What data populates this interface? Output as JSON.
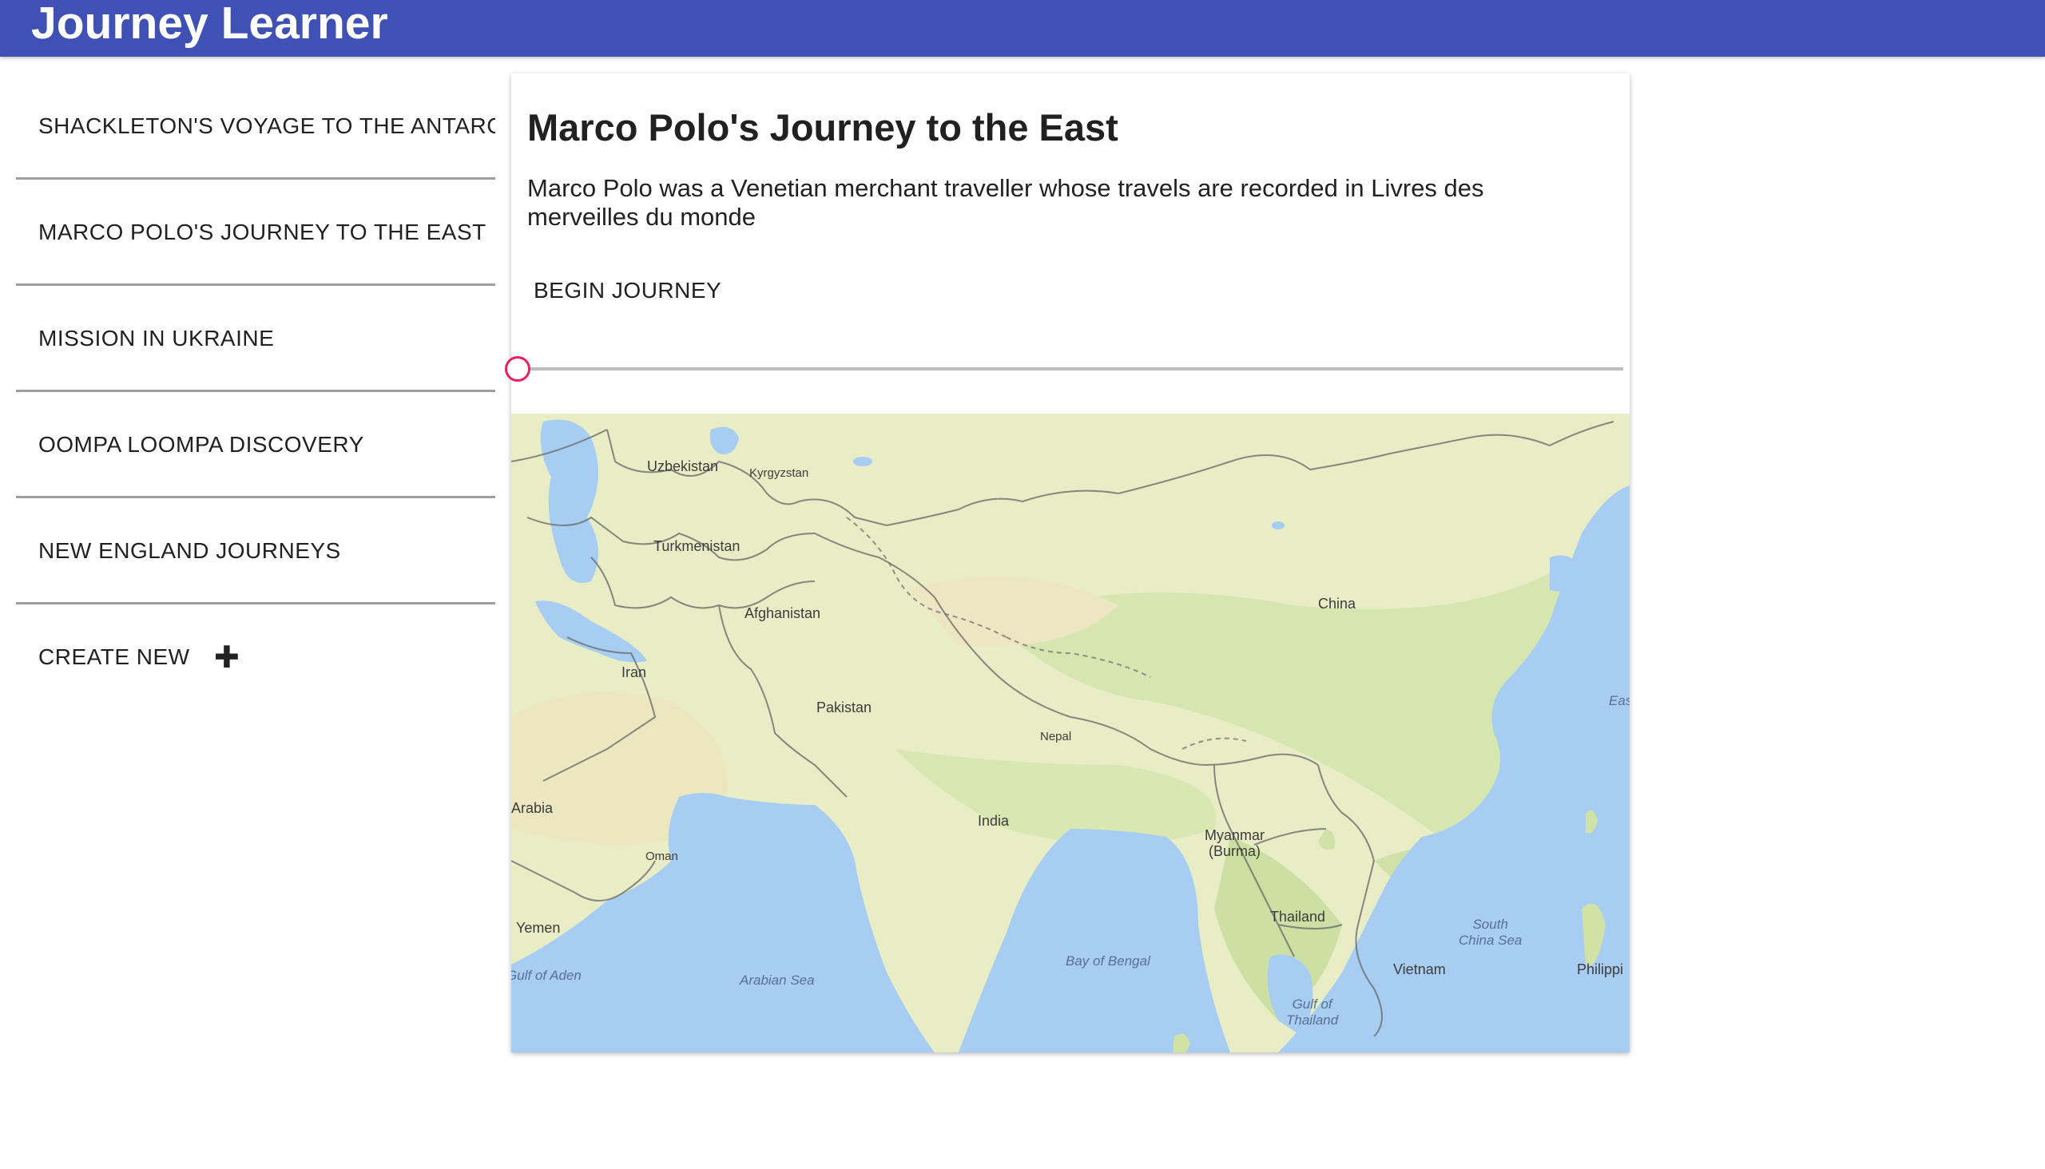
{
  "app": {
    "title": "Journey Learner",
    "bar_color": "#3f51b5"
  },
  "sidebar": {
    "items": [
      {
        "label": "SHACKLETON'S VOYAGE TO THE ANTARCTIC"
      },
      {
        "label": "MARCO POLO'S JOURNEY TO THE EAST"
      },
      {
        "label": "MISSION IN UKRAINE"
      },
      {
        "label": "OOMPA LOOMPA DISCOVERY"
      },
      {
        "label": "NEW ENGLAND JOURNEYS"
      }
    ],
    "create_new": {
      "label": "CREATE NEW",
      "icon": "plus-icon"
    }
  },
  "journey": {
    "title": "Marco Polo's Journey to the East",
    "description": "Marco Polo was a Venetian merchant traveller whose travels are recorded in Livres des merveilles du monde",
    "begin_label": "BEGIN JOURNEY",
    "progress": 0,
    "slider_color": "#e91e63"
  },
  "map": {
    "labels": {
      "uzbekistan": "Uzbekistan",
      "kyrgyzstan": "Kyrgyzstan",
      "turkmenistan": "Turkmenistan",
      "afghanistan": "Afghanistan",
      "iran": "Iran",
      "pakistan": "Pakistan",
      "china": "China",
      "nepal": "Nepal",
      "india": "India",
      "arabia": "Arabia",
      "oman": "Oman",
      "myanmar": "Myanmar\n(Burma)",
      "thailand": "Thailand",
      "yemen": "Yemen",
      "gulf_of_aden": "Gulf of Aden",
      "arabian_sea": "Arabian Sea",
      "bay_of_bengal": "Bay of Bengal",
      "south_china_sea": "South\nChina Sea",
      "vietnam": "Vietnam",
      "philippines": "Philippi",
      "gulf_of_thailand": "Gulf of\nThailand",
      "east": "Eas"
    },
    "colors": {
      "water": "#a7cdf2",
      "land": "#e6ecc0",
      "green": "#c8dea0"
    }
  }
}
